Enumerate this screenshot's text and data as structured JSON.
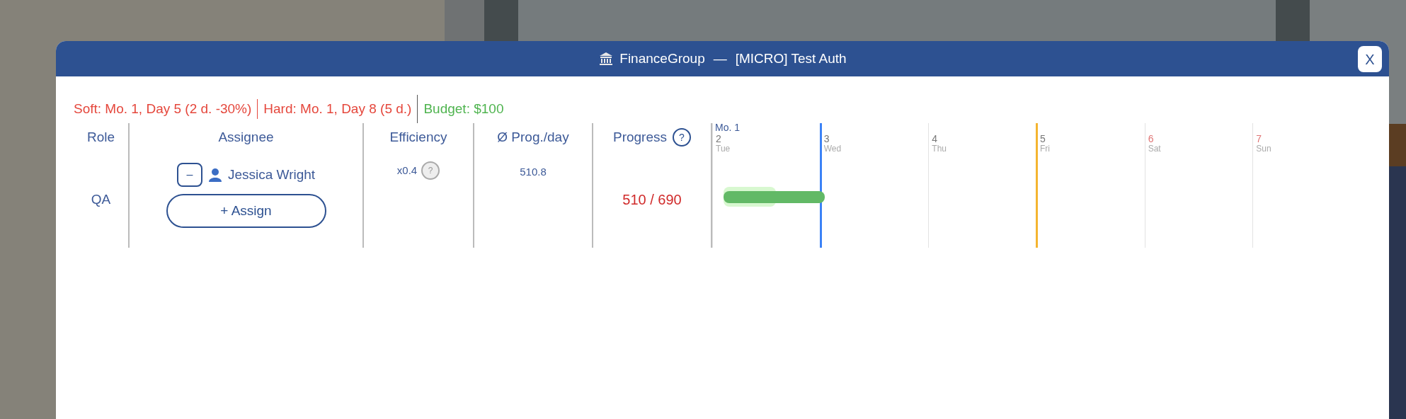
{
  "window": {
    "title": "FinanceGroup",
    "separator": "—",
    "subtitle": "[MICRO] Test Auth",
    "close": "X"
  },
  "summary": {
    "soft": "Soft: Mo. 1, Day 5 (2 d. -30%)",
    "hard": "Hard: Mo. 1, Day 8 (5 d.)",
    "budget": "Budget: $100"
  },
  "columns": [
    "Role",
    "Assignee",
    "Efficiency",
    "Ø Prog./day",
    "Progress"
  ],
  "progress_help": "?",
  "rows": [
    {
      "role": "QA",
      "assignees": [
        {
          "remove": "–",
          "name": "Jessica Wright"
        }
      ],
      "assign": "+ Assign",
      "efficiency": "x0.4",
      "efficiency_help": "?",
      "per_day": "510.8",
      "progress": "510 / 690"
    }
  ],
  "timeline": {
    "month": "Mo. 1",
    "days": [
      {
        "number": "2",
        "weekday": "Tue",
        "weekend": false,
        "today": false,
        "soft_deadline": false
      },
      {
        "number": "3",
        "weekday": "Wed",
        "weekend": false,
        "today": true,
        "soft_deadline": false
      },
      {
        "number": "4",
        "weekday": "Thu",
        "weekend": false,
        "today": false,
        "soft_deadline": false
      },
      {
        "number": "5",
        "weekday": "Fri",
        "weekend": false,
        "today": false,
        "soft_deadline": true
      },
      {
        "number": "6",
        "weekday": "Sat",
        "weekend": true,
        "today": false,
        "soft_deadline": false
      },
      {
        "number": "7",
        "weekday": "Sun",
        "weekend": true,
        "today": false,
        "soft_deadline": false
      }
    ]
  }
}
